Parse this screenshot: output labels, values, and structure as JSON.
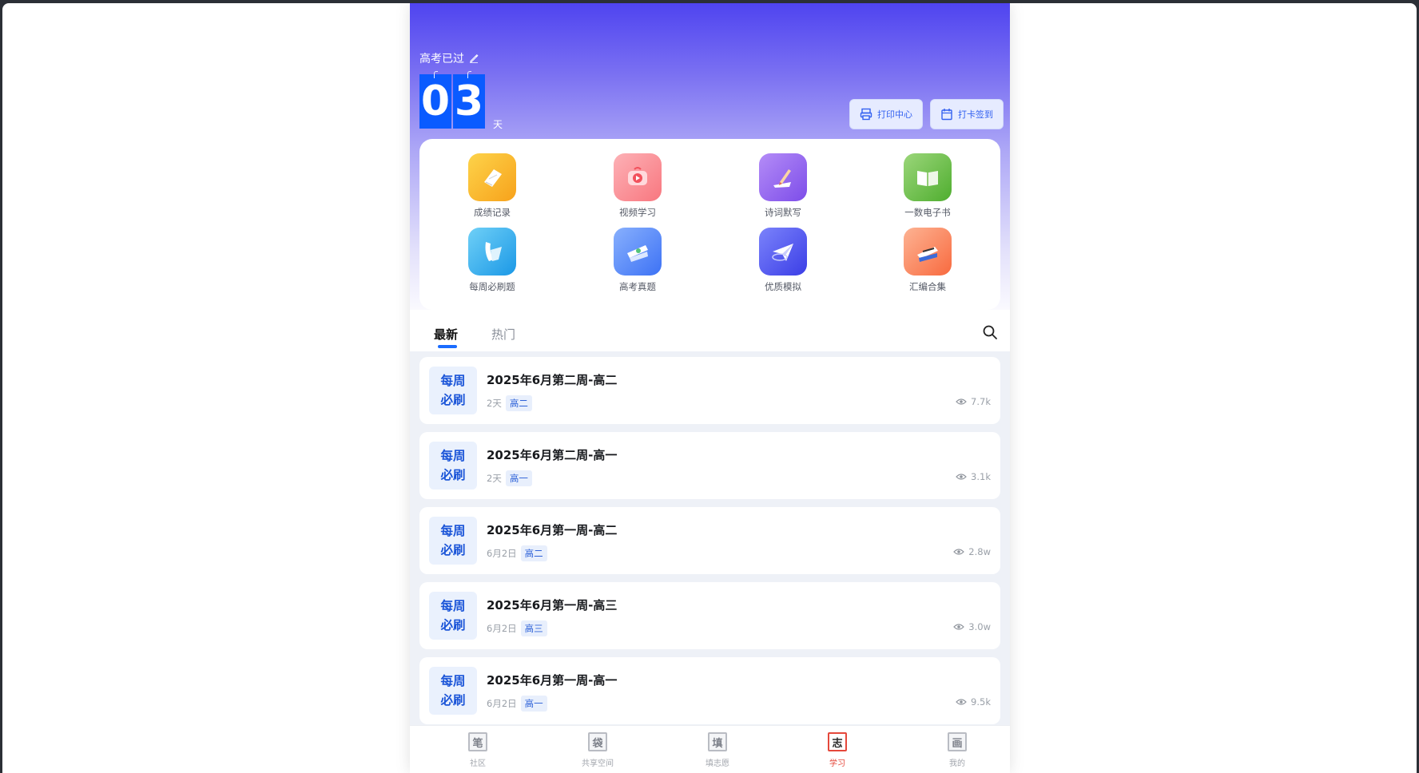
{
  "countdown": {
    "title": "高考已过",
    "digits": [
      "0",
      "3"
    ],
    "unit": "天"
  },
  "hero_buttons": [
    {
      "label": "打印中心",
      "icon": "printer-icon"
    },
    {
      "label": "打卡签到",
      "icon": "calendar-icon"
    }
  ],
  "grid": [
    {
      "label": "成绩记录",
      "icon": "notebook-icon",
      "color": "#fbb416"
    },
    {
      "label": "视频学习",
      "icon": "video-play-icon",
      "color": "#fb8f96"
    },
    {
      "label": "诗词默写",
      "icon": "pen-paper-icon",
      "color": "#9365ef"
    },
    {
      "label": "一数电子书",
      "icon": "open-book-icon",
      "color": "#6fc04a"
    },
    {
      "label": "每周必刷题",
      "icon": "paper-sheets-icon",
      "color": "#2fa9ee"
    },
    {
      "label": "高考真题",
      "icon": "paper-roll-icon",
      "color": "#5b8bfb"
    },
    {
      "label": "优质模拟",
      "icon": "paper-plane-icon",
      "color": "#5158f2"
    },
    {
      "label": "汇编合集",
      "icon": "ruler-pen-icon",
      "color": "#fb7d52"
    }
  ],
  "tabs": {
    "latest": "最新",
    "hot": "热门"
  },
  "items": [
    {
      "badge_top": "每周",
      "badge_bottom": "必刷",
      "title": "2025年6月第二周-高二",
      "date": "2天",
      "tag": "高二",
      "views": "7.7k"
    },
    {
      "badge_top": "每周",
      "badge_bottom": "必刷",
      "title": "2025年6月第二周-高一",
      "date": "2天",
      "tag": "高一",
      "views": "3.1k"
    },
    {
      "badge_top": "每周",
      "badge_bottom": "必刷",
      "title": "2025年6月第一周-高二",
      "date": "6月2日",
      "tag": "高二",
      "views": "2.8w"
    },
    {
      "badge_top": "每周",
      "badge_bottom": "必刷",
      "title": "2025年6月第一周-高三",
      "date": "6月2日",
      "tag": "高三",
      "views": "3.0w"
    },
    {
      "badge_top": "每周",
      "badge_bottom": "必刷",
      "title": "2025年6月第一周-高一",
      "date": "6月2日",
      "tag": "高一",
      "views": "9.5k"
    }
  ],
  "bottom_nav": [
    {
      "glyph": "笔",
      "label": "社区",
      "active": false
    },
    {
      "glyph": "袋",
      "label": "共享空间",
      "active": false
    },
    {
      "glyph": "填",
      "label": "填志愿",
      "active": false
    },
    {
      "glyph": "志",
      "label": "学习",
      "active": true
    },
    {
      "glyph": "画",
      "label": "我的",
      "active": false
    }
  ],
  "colors": {
    "accent": "#1a6cff",
    "hero_top": "#4f44f0",
    "nav_active": "#e5483b"
  }
}
